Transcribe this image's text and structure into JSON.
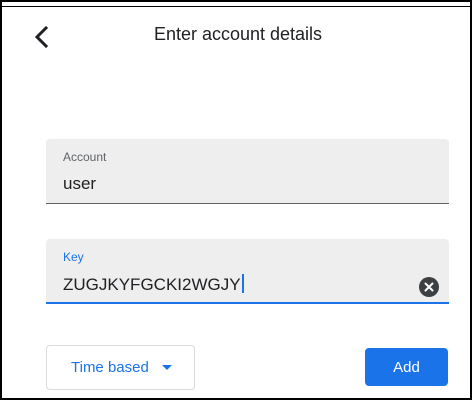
{
  "header": {
    "title": "Enter account details",
    "back_icon": "chevron-left-icon"
  },
  "form": {
    "account": {
      "label": "Account",
      "value": "user"
    },
    "key": {
      "label": "Key",
      "value": "ZUGJKYFGCKI2WGJY",
      "clear_icon": "clear-icon"
    }
  },
  "footer": {
    "key_type": "Time based",
    "dropdown_icon": "dropdown-arrow-icon",
    "add_label": "Add"
  },
  "colors": {
    "accent": "#1a73e8",
    "field_background": "#eeeeee",
    "text": "#202124",
    "label": "#5f6368"
  }
}
